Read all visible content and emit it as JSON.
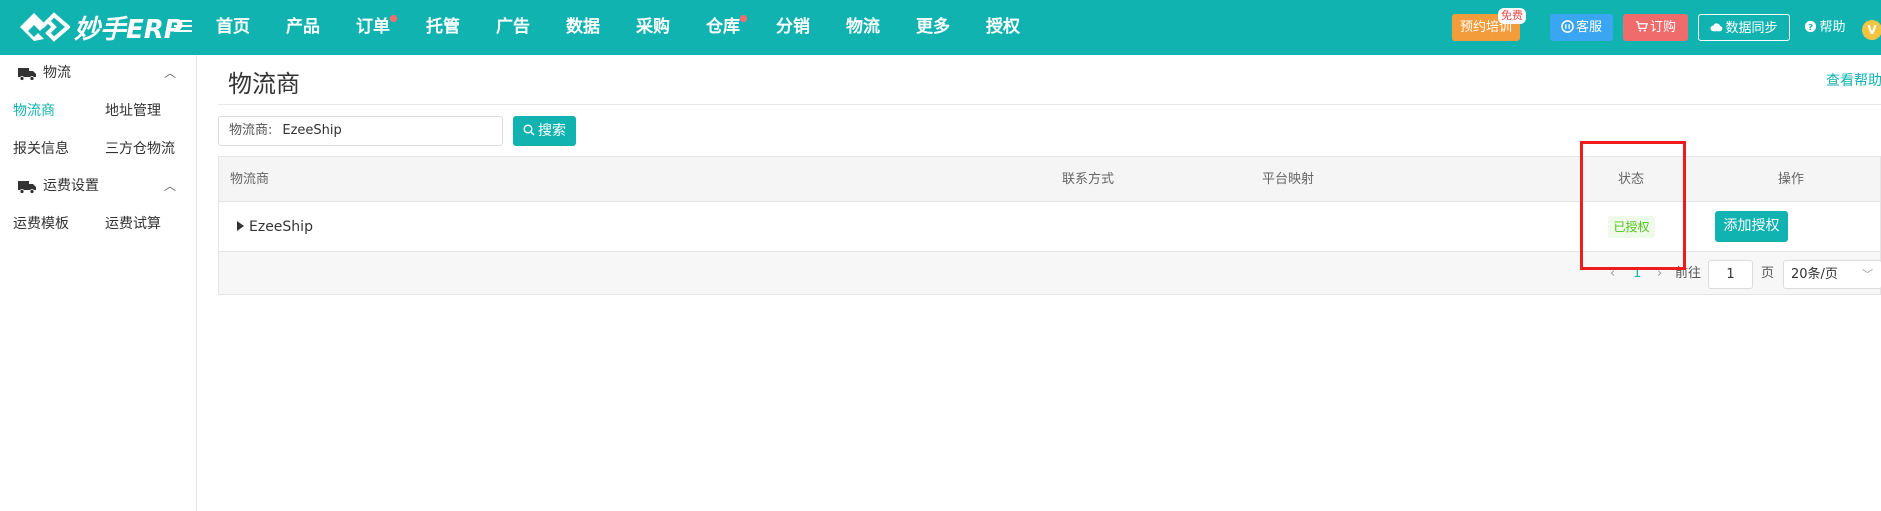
{
  "header": {
    "logo_text": "妙手ERP",
    "nav": [
      {
        "label": "首页",
        "dot": false
      },
      {
        "label": "产品",
        "dot": false
      },
      {
        "label": "订单",
        "dot": true
      },
      {
        "label": "托管",
        "dot": false
      },
      {
        "label": "广告",
        "dot": false
      },
      {
        "label": "数据",
        "dot": false
      },
      {
        "label": "采购",
        "dot": false
      },
      {
        "label": "仓库",
        "dot": true
      },
      {
        "label": "分销",
        "dot": false
      },
      {
        "label": "物流",
        "dot": false
      },
      {
        "label": "更多",
        "dot": false
      },
      {
        "label": "授权",
        "dot": false
      }
    ],
    "train_label": "预约培训",
    "free_badge": "免费",
    "service_label": "客服",
    "order_label": "订购",
    "sync_label": "数据同步",
    "help_label": "帮助",
    "vip_label": "V"
  },
  "sidebar": {
    "groups": [
      {
        "title": "物流",
        "items": [
          [
            "物流商",
            "地址管理"
          ],
          [
            "报关信息",
            "三方仓物流"
          ]
        ]
      },
      {
        "title": "运费设置",
        "items": [
          [
            "运费模板",
            "运费试算"
          ]
        ]
      }
    ],
    "active_item": "物流商"
  },
  "main": {
    "title": "物流商",
    "help_link": "查看帮助",
    "filter": {
      "label": "物流商:",
      "value": "EzeeShip"
    },
    "search_label": "搜索",
    "table": {
      "columns": [
        "物流商",
        "联系方式",
        "平台映射",
        "状态",
        "操作"
      ],
      "rows": [
        {
          "carrier": "EzeeShip",
          "contact": "",
          "mapping": "",
          "status": "已授权",
          "action": "添加授权"
        }
      ]
    },
    "pagination": {
      "current_page": "1",
      "goto_label": "前往",
      "goto_value": "1",
      "page_suffix": "页",
      "page_size": "20条/页"
    }
  },
  "colors": {
    "brand": "#11b3b1",
    "train": "#f39c3c",
    "service": "#3aa5f0",
    "order": "#f06b6b",
    "status_green": "#52c41a",
    "highlight": "#ee1c1c"
  },
  "icons": [
    "logo-icon",
    "menu-icon",
    "service-icon",
    "cart-icon",
    "cloud-sync-icon",
    "help-icon",
    "truck-icon",
    "chevron-up-icon",
    "search-icon",
    "expand-arrow-icon",
    "chevron-down-icon"
  ]
}
